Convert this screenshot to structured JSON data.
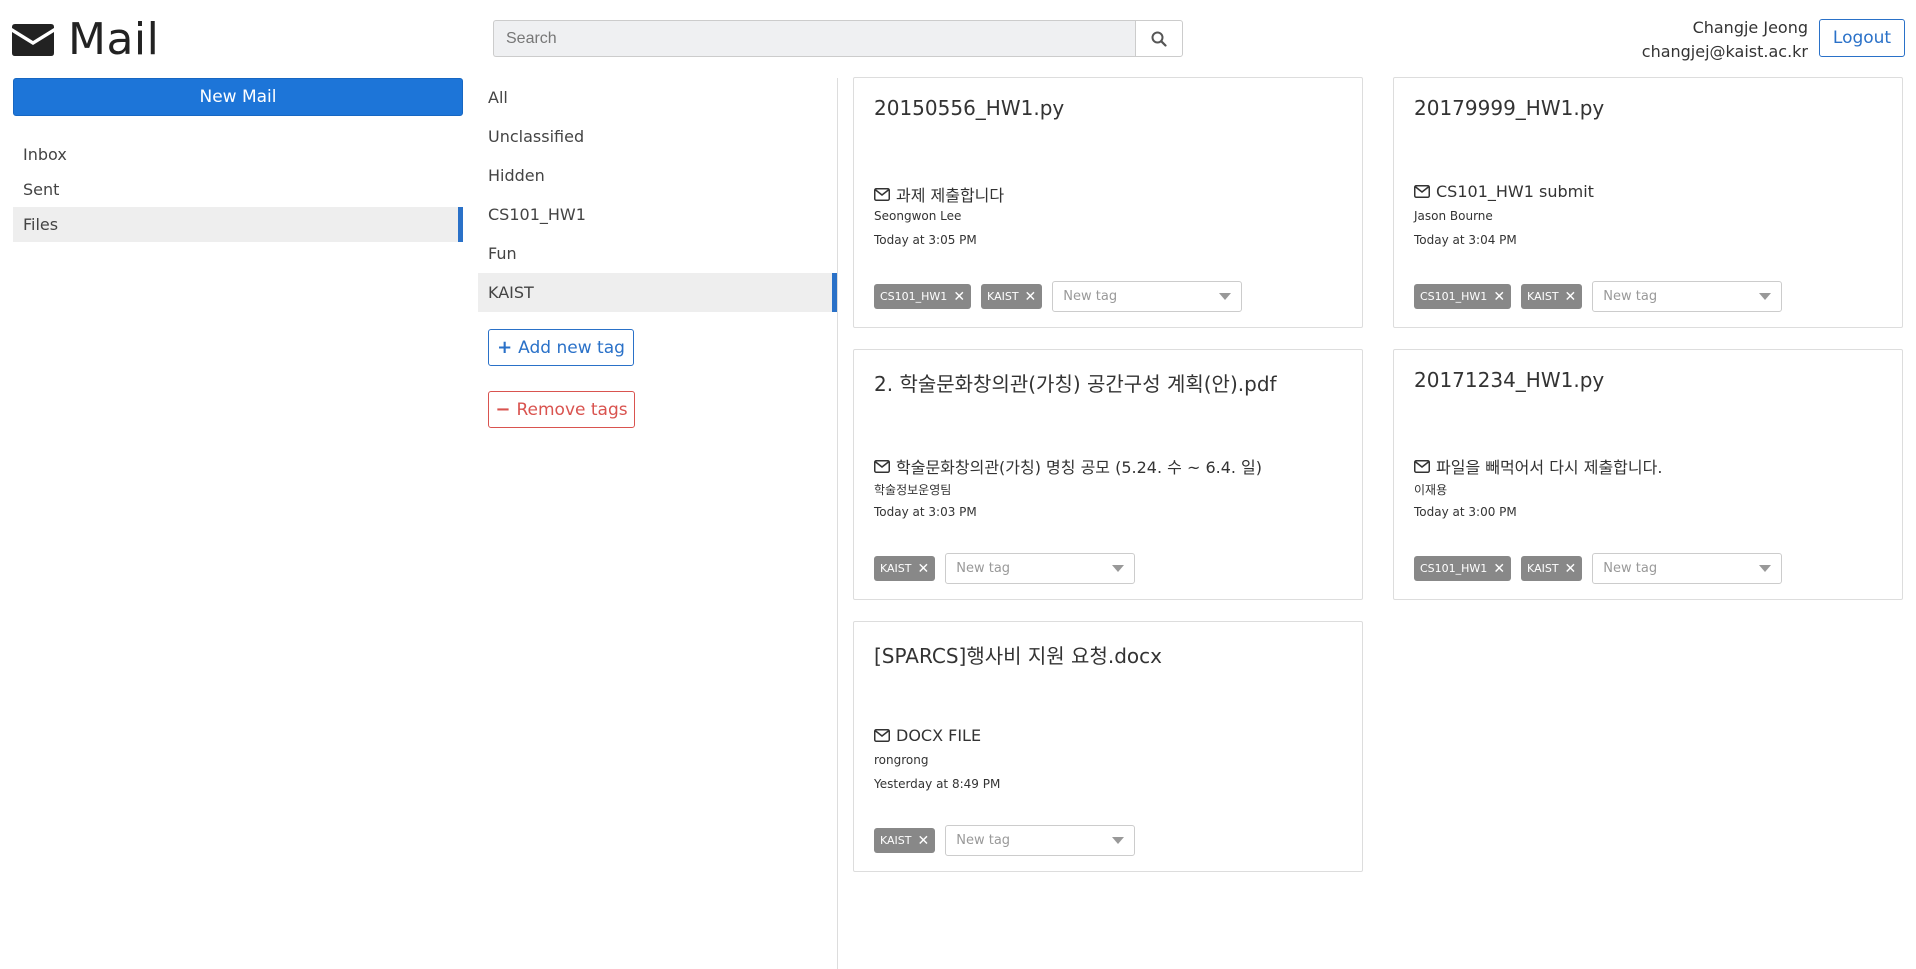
{
  "app": {
    "title": "Mail"
  },
  "sidebar": {
    "new_mail_label": "New Mail",
    "items": [
      {
        "label": "Inbox",
        "active": false
      },
      {
        "label": "Sent",
        "active": false
      },
      {
        "label": "Files",
        "active": true
      }
    ]
  },
  "search": {
    "placeholder": "Search",
    "value": ""
  },
  "user": {
    "name": "Changje Jeong",
    "email": "changjej@kaist.ac.kr",
    "logout_label": "Logout"
  },
  "tags_panel": {
    "items": [
      {
        "label": "All",
        "active": false
      },
      {
        "label": "Unclassified",
        "active": false
      },
      {
        "label": "Hidden",
        "active": false
      },
      {
        "label": "CS101_HW1",
        "active": false
      },
      {
        "label": "Fun",
        "active": false
      },
      {
        "label": "KAIST",
        "active": true
      }
    ],
    "add_label": "Add new tag",
    "remove_label": "Remove tags"
  },
  "files": [
    {
      "filename": "20150556_HW1.py",
      "subject": "과제 제출합니다",
      "sender": "Seongwon Lee",
      "time": "Today at 3:05 PM",
      "tags": [
        "CS101_HW1",
        "KAIST"
      ],
      "new_tag_placeholder": "New tag"
    },
    {
      "filename": "20179999_HW1.py",
      "subject": "CS101_HW1 submit",
      "sender": "Jason Bourne",
      "time": "Today at 3:04 PM",
      "tags": [
        "CS101_HW1",
        "KAIST"
      ],
      "new_tag_placeholder": "New tag"
    },
    {
      "filename": "2. 학술문화창의관(가칭) 공간구성 계획(안).pdf",
      "subject": "학술문화창의관(가칭) 명칭 공모 (5.24. 수 ~ 6.4. 일)",
      "sender": "학술정보운영팀",
      "time": "Today at 3:03 PM",
      "tags": [
        "KAIST"
      ],
      "new_tag_placeholder": "New tag"
    },
    {
      "filename": "20171234_HW1.py",
      "subject": "파일을 빼먹어서 다시 제출합니다.",
      "sender": "이재용",
      "time": "Today at 3:00 PM",
      "tags": [
        "CS101_HW1",
        "KAIST"
      ],
      "new_tag_placeholder": "New tag"
    },
    {
      "filename": "[SPARCS]행사비 지원 요청.docx",
      "subject": "DOCX FILE",
      "sender": "rongrong",
      "time": "Yesterday at 8:49 PM",
      "tags": [
        "KAIST"
      ],
      "new_tag_placeholder": "New tag"
    }
  ],
  "icons": {
    "brand": "envelope-icon",
    "search": "search-icon",
    "add": "plus-icon",
    "remove": "minus-icon",
    "tag_remove": "close-icon",
    "dropdown": "caret-down-icon",
    "subject": "envelope-outline-icon"
  },
  "colors": {
    "primary": "#1d75d8",
    "danger": "#d9534f",
    "chip": "#888888",
    "active_bg": "#eeeeee"
  }
}
